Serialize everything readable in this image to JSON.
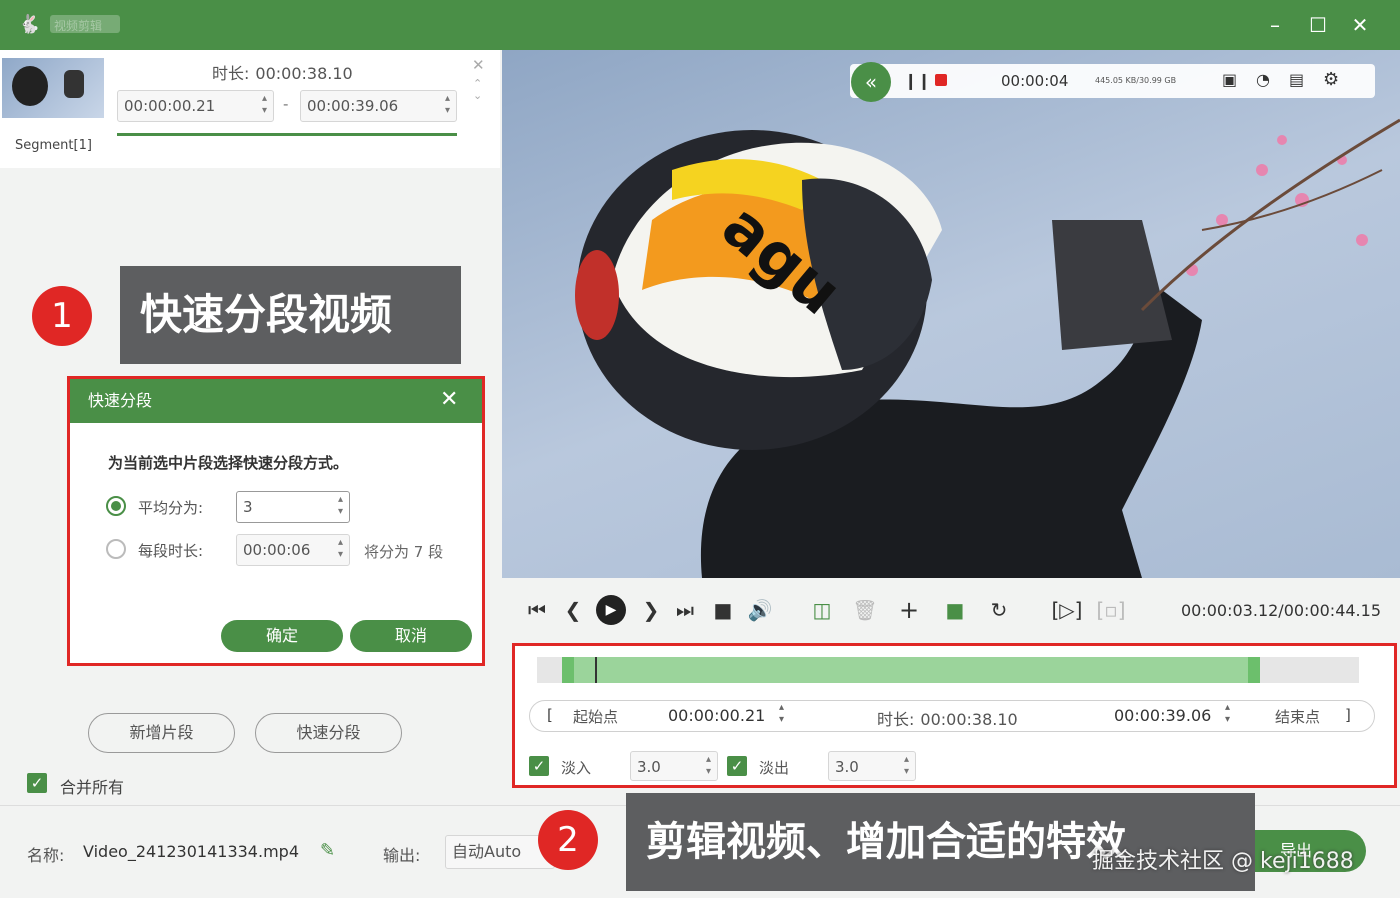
{
  "app": {
    "title": "视频剪辑",
    "window_controls": [
      "minimize-icon",
      "maximize-icon",
      "close-icon"
    ]
  },
  "segment": {
    "name": "Segment[1]",
    "duration_label": "时长:",
    "duration_value": "00:00:38.10",
    "start": "00:00:00.21",
    "end": "00:00:39.06",
    "separator": "-"
  },
  "callout1": {
    "number": "1",
    "text": "快速分段视频"
  },
  "callout2": {
    "number": "2",
    "text": "剪辑视频、增加合适的特效"
  },
  "dialog": {
    "title": "快速分段",
    "prompt": "为当前选中片段选择快速分段方式。",
    "option1_label": "平均分为:",
    "option1_value": "3",
    "option2_label": "每段时长:",
    "option2_value": "00:00:06",
    "option2_hint": "将分为 7 段",
    "ok": "确定",
    "cancel": "取消"
  },
  "left_buttons": {
    "add_segment": "新增片段",
    "quick_split": "快速分段"
  },
  "merge_all": "合并所有",
  "preview": {
    "time": "00:00:04",
    "storage": "445.05 KB/30.99 GB"
  },
  "player": {
    "time_display": "00:00:03.12/00:00:44.15"
  },
  "timeline": {
    "start_label": "起始点",
    "start_value": "00:00:00.21",
    "duration_label": "时长:",
    "duration_value": "00:00:38.10",
    "end_value": "00:00:39.06",
    "end_label": "结束点",
    "fade_in_label": "淡入",
    "fade_in_value": "3.0",
    "fade_out_label": "淡出",
    "fade_out_value": "3.0",
    "selection_start": 0.03,
    "selection_end": 0.88,
    "playhead": 0.07
  },
  "bottom": {
    "name_label": "名称:",
    "name_value": "Video_241230141334.mp4",
    "output_label": "输出:",
    "output_value": "自动Auto",
    "export_label": "导出"
  },
  "watermark": "掘金技术社区 @ keji1688",
  "colors": {
    "accent": "#4a8f47",
    "highlight": "#e02725",
    "callout_bg": "#5d5e60"
  }
}
